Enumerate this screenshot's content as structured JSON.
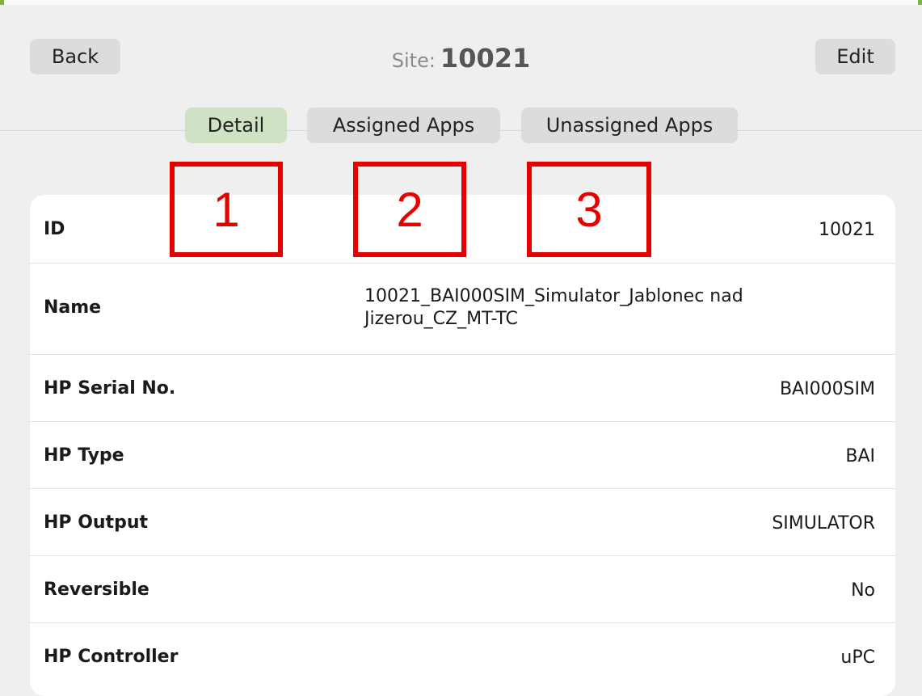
{
  "header": {
    "back_label": "Back",
    "edit_label": "Edit",
    "title_label": "Site:",
    "title_value": "10021"
  },
  "tabs": [
    {
      "label": "Detail",
      "active": true
    },
    {
      "label": "Assigned Apps",
      "active": false
    },
    {
      "label": "Unassigned Apps",
      "active": false
    }
  ],
  "details": [
    {
      "label": "ID",
      "value": "10021"
    },
    {
      "label": "Name",
      "value_line1": "10021_BAI000SIM_Simulator_Jablonec nad",
      "value_line2": "Jizerou_CZ_MT-TC"
    },
    {
      "label": "HP Serial No.",
      "value": "BAI000SIM"
    },
    {
      "label": "HP Type",
      "value": "BAI"
    },
    {
      "label": "HP Output",
      "value": "SIMULATOR"
    },
    {
      "label": "Reversible",
      "value": "No"
    },
    {
      "label": "HP Controller",
      "value": "uPC"
    }
  ],
  "markers": [
    "1",
    "2",
    "3"
  ],
  "colors": {
    "active_tab": "#cfe3c4",
    "button": "#dcdcdc",
    "marker": "#e60000",
    "background": "#efefef",
    "card": "#ffffff"
  }
}
